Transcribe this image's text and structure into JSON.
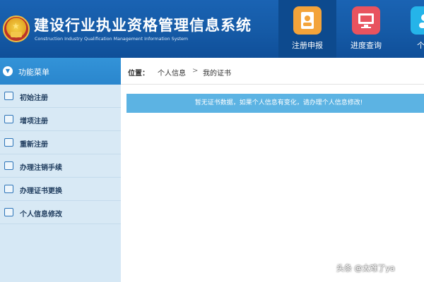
{
  "header": {
    "title": "建设行业执业资格管理信息系统",
    "subtitle": "Construction Industry Qualification Management Information System",
    "tabs": [
      {
        "label": "注册申报",
        "icon": "contact-card-icon",
        "active": true,
        "color": "#f3a33a"
      },
      {
        "label": "进度查询",
        "icon": "monitor-icon",
        "active": false,
        "color": "#e8535f"
      },
      {
        "label": "个人",
        "icon": "person-icon",
        "active": false,
        "color": "#25b4e9"
      }
    ]
  },
  "sidebar": {
    "title": "功能菜单",
    "items": [
      {
        "label": "初始注册",
        "icon": "register-icon"
      },
      {
        "label": "增项注册",
        "icon": "chat-icon"
      },
      {
        "label": "重新注册",
        "icon": "edit-icon"
      },
      {
        "label": "办理注销手续",
        "icon": "calendar-icon"
      },
      {
        "label": "办理证书更换",
        "icon": "calendar-icon"
      },
      {
        "label": "个人信息修改",
        "icon": "grid-icon"
      }
    ]
  },
  "breadcrumb": {
    "label": "位置：",
    "items": [
      "个人信息",
      "我的证书"
    ],
    "separator": ">"
  },
  "notice": {
    "text": "暂无证书数据，如果个人信息有变化，请办理个人信息修改!"
  },
  "watermark": "头条 @太难了ya",
  "colors": {
    "header_blue": "#155aa6",
    "sidebar_bg": "#d6e8f5",
    "notice_bg": "#5cb3e3"
  }
}
